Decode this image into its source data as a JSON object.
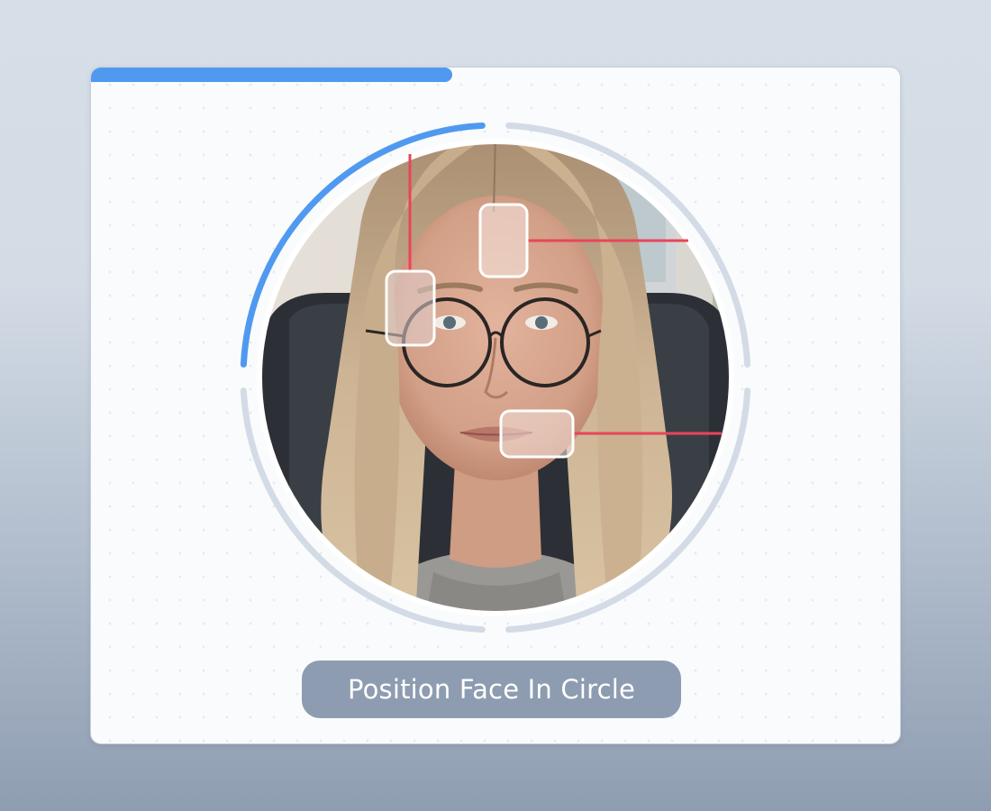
{
  "scan": {
    "progress_fraction": 0.446,
    "ring_progress_fraction": 0.25,
    "instruction": "Position Face In Circle"
  },
  "colors": {
    "progress_bar": "#4f9af0",
    "ring_active": "#4f9af0",
    "ring_inactive": "#d3dbe6",
    "marker_line": "#e8455a",
    "marker_box_border": "#ffffff",
    "instruction_pill": "#8d9cb0"
  },
  "markers": [
    {
      "name": "forehead-marker",
      "line_direction": "right"
    },
    {
      "name": "eye-marker",
      "line_direction": "up"
    },
    {
      "name": "cheek-marker",
      "line_direction": "right"
    }
  ]
}
